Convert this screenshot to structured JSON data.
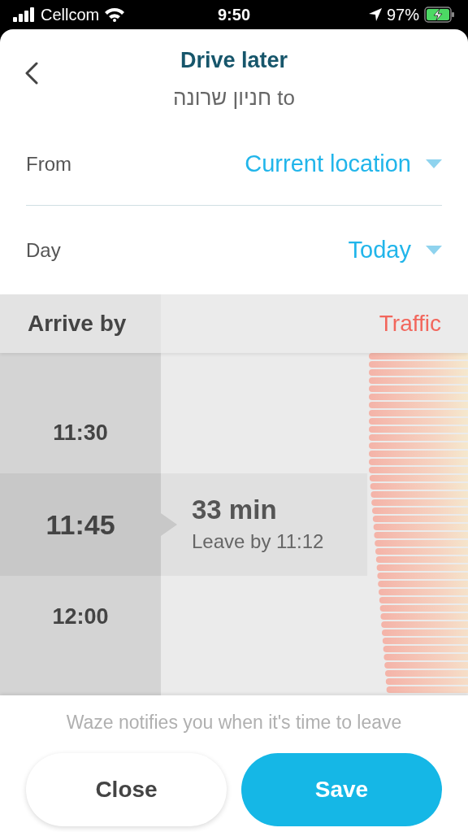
{
  "status_bar": {
    "carrier": "Cellcom",
    "time": "9:50",
    "battery": "97%"
  },
  "header": {
    "title": "Drive later",
    "subtitle": "חניון שרונה to"
  },
  "fields": [
    {
      "label": "From",
      "value": "Current location"
    },
    {
      "label": "Day",
      "value": "Today"
    }
  ],
  "table": {
    "columns": [
      "Arrive by",
      "Traffic"
    ],
    "rows": [
      {
        "time": "11:30",
        "selected": false
      },
      {
        "time": "11:45",
        "selected": true,
        "duration": "33 min",
        "leave_by": "Leave by 11:12"
      },
      {
        "time": "12:00",
        "selected": false
      }
    ]
  },
  "footer": {
    "note": "Waze notifies you when it's time to leave",
    "buttons": [
      {
        "label": "Close",
        "kind": "secondary"
      },
      {
        "label": "Save",
        "kind": "primary"
      }
    ]
  }
}
